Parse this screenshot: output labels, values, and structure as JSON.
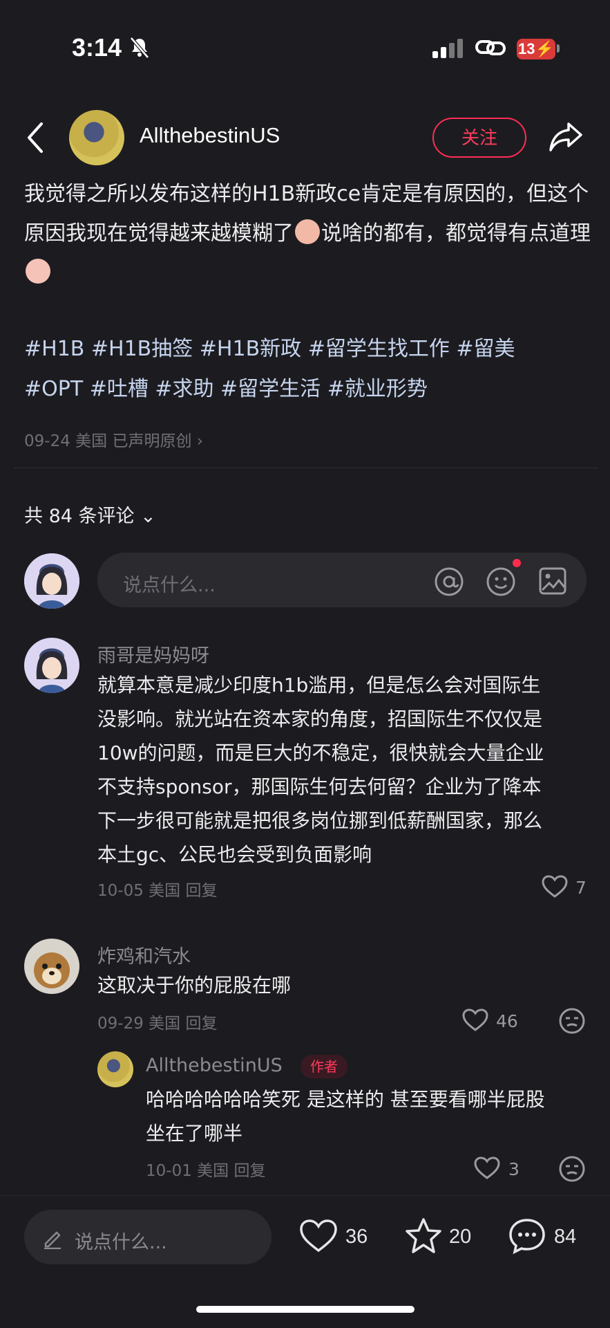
{
  "status": {
    "time": "3:14",
    "battery": "13"
  },
  "header": {
    "author": "AllthebestinUS",
    "follow_label": "关注"
  },
  "post": {
    "text_1": "我觉得之所以发布这样的H1B新政ce肯定是有原因的，但这个原因我现在觉得越来越模糊了",
    "text_2": "说啥的都有，都觉得有点道理",
    "tags_line1": "#H1B #H1B抽签 #H1B新政 #留学生找工作 #留美",
    "tags_line2": "#OPT #吐槽 #求助 #留学生活 #就业形势",
    "meta": "09-24 美国 已声明原创"
  },
  "comments_header": {
    "count_label": "共 84 条评论"
  },
  "comment_input": {
    "placeholder": "说点什么..."
  },
  "comments": [
    {
      "name": "雨哥是妈妈呀",
      "lines": [
        "就算本意是减少印度h1b滥用，但是怎么会对国际生",
        "没影响。就光站在资本家的角度，招国际生不仅仅是",
        "10w的问题，而是巨大的不稳定，很快就会大量企业",
        "不支持sponsor，那国际生何去何留？企业为了降本",
        "下一步很可能就是把很多岗位挪到低薪酬国家，那么",
        "本土gc、公民也会受到负面影响"
      ],
      "meta": "10-05 美国 回复",
      "likes": "7"
    },
    {
      "name": "炸鸡和汽水",
      "lines": [
        "这取决于你的屁股在哪"
      ],
      "meta": "09-29 美国 回复",
      "likes": "46"
    },
    {
      "name": "AllthebestinUS",
      "author_tag": "作者",
      "lines": [
        "哈哈哈哈哈哈笑死 是这样的 甚至要看哪半屁股",
        "坐在了哪半"
      ],
      "meta": "10-01 美国 回复",
      "likes": "3"
    }
  ],
  "bottom_bar": {
    "placeholder": "说点什么...",
    "likes": "36",
    "stars": "20",
    "comments": "84"
  }
}
